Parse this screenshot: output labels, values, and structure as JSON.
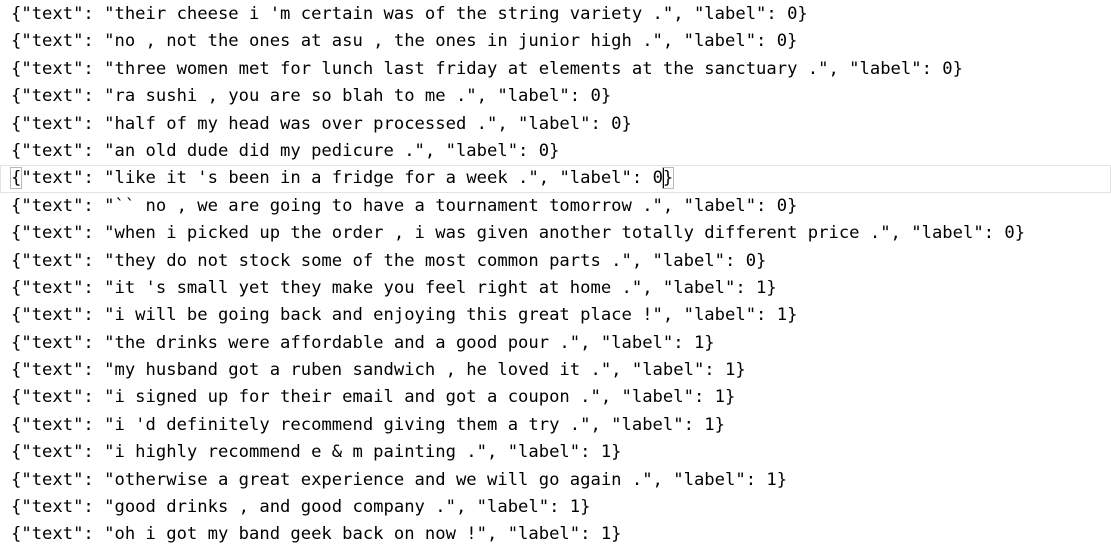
{
  "editor": {
    "lines": [
      "{\"text\": \"their cheese i 'm certain was of the string variety .\", \"label\": 0}",
      "{\"text\": \"no , not the ones at asu , the ones in junior high .\", \"label\": 0}",
      "{\"text\": \"three women met for lunch last friday at elements at the sanctuary .\", \"label\": 0}",
      "{\"text\": \"ra sushi , you are so blah to me .\", \"label\": 0}",
      "{\"text\": \"half of my head was over processed .\", \"label\": 0}",
      "{\"text\": \"an old dude did my pedicure .\", \"label\": 0}",
      "{\"text\": \"like it 's been in a fridge for a week .\", \"label\": 0}",
      "{\"text\": \"`` no , we are going to have a tournament tomorrow .\", \"label\": 0}",
      "{\"text\": \"when i picked up the order , i was given another totally different price .\", \"label\": 0}",
      "{\"text\": \"they do not stock some of the most common parts .\", \"label\": 0}",
      "{\"text\": \"it 's small yet they make you feel right at home .\", \"label\": 1}",
      "{\"text\": \"i will be going back and enjoying this great place !\", \"label\": 1}",
      "{\"text\": \"the drinks were affordable and a good pour .\", \"label\": 1}",
      "{\"text\": \"my husband got a ruben sandwich , he loved it .\", \"label\": 1}",
      "{\"text\": \"i signed up for their email and got a coupon .\", \"label\": 1}",
      "{\"text\": \"i 'd definitely recommend giving them a try .\", \"label\": 1}",
      "{\"text\": \"i highly recommend e & m painting .\", \"label\": 1}",
      "{\"text\": \"otherwise a great experience and we will go again .\", \"label\": 1}",
      "{\"text\": \"good drinks , and good company .\", \"label\": 1}",
      "{\"text\": \"oh i got my band geek back on now !\", \"label\": 1}"
    ],
    "current_line": {
      "open_brace": "{",
      "body": "\"text\": \"like it 's been in a fridge for a week .\", \"label\": 0",
      "close_brace": "}"
    }
  }
}
